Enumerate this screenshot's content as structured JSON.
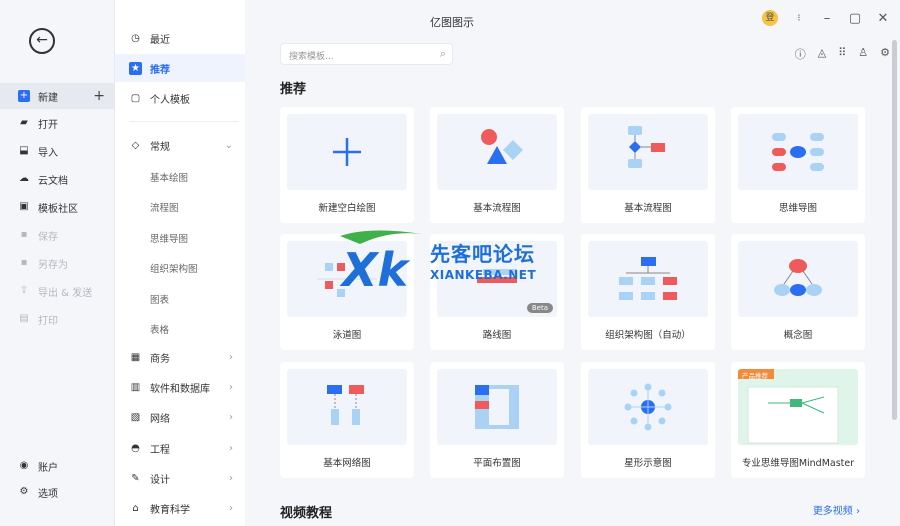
{
  "app": {
    "title": "亿图图示",
    "login_label": "登"
  },
  "leftnav": {
    "items": [
      {
        "label": "新建",
        "icon": "new-icon"
      },
      {
        "label": "打开",
        "icon": "folder-icon"
      },
      {
        "label": "导入",
        "icon": "import-icon"
      },
      {
        "label": "云文档",
        "icon": "cloud-icon"
      },
      {
        "label": "模板社区",
        "icon": "community-icon"
      },
      {
        "label": "保存",
        "icon": "save-icon"
      },
      {
        "label": "另存为",
        "icon": "save-as-icon"
      },
      {
        "label": "导出 & 发送",
        "icon": "export-icon"
      },
      {
        "label": "打印",
        "icon": "print-icon"
      }
    ],
    "account_label": "账户",
    "options_label": "选项"
  },
  "categories": {
    "recent": "最近",
    "recommended": "推荐",
    "personal": "个人模板",
    "general": "常规",
    "general_sub": [
      "基本绘图",
      "流程图",
      "思维导图",
      "组织架构图",
      "图表",
      "表格"
    ],
    "business": "商务",
    "software": "软件和数据库",
    "network": "网络",
    "engineering": "工程",
    "design": "设计",
    "education": "教育科学"
  },
  "search": {
    "placeholder": "搜索模板..."
  },
  "main": {
    "section_title": "推荐",
    "video_title": "视频教程",
    "more_videos": "更多视频 ›",
    "cards": [
      {
        "label": "新建空白绘图"
      },
      {
        "label": "基本流程图"
      },
      {
        "label": "基本流程图"
      },
      {
        "label": "思维导图"
      },
      {
        "label": "泳道图"
      },
      {
        "label": "路线图",
        "badge": "Beta"
      },
      {
        "label": "组织架构图（自动）"
      },
      {
        "label": "概念图"
      },
      {
        "label": "基本网络图"
      },
      {
        "label": "平面布置图"
      },
      {
        "label": "星形示意图"
      },
      {
        "label": "专业思维导图MindMaster",
        "tag": "产品推荐"
      }
    ]
  },
  "watermark": {
    "brand": "先客吧论坛",
    "domain": "XIANKEBA.NET"
  },
  "colors": {
    "accent": "#2b6ef2",
    "red": "#ef5a5a",
    "lightblue": "#a9d2f5"
  }
}
